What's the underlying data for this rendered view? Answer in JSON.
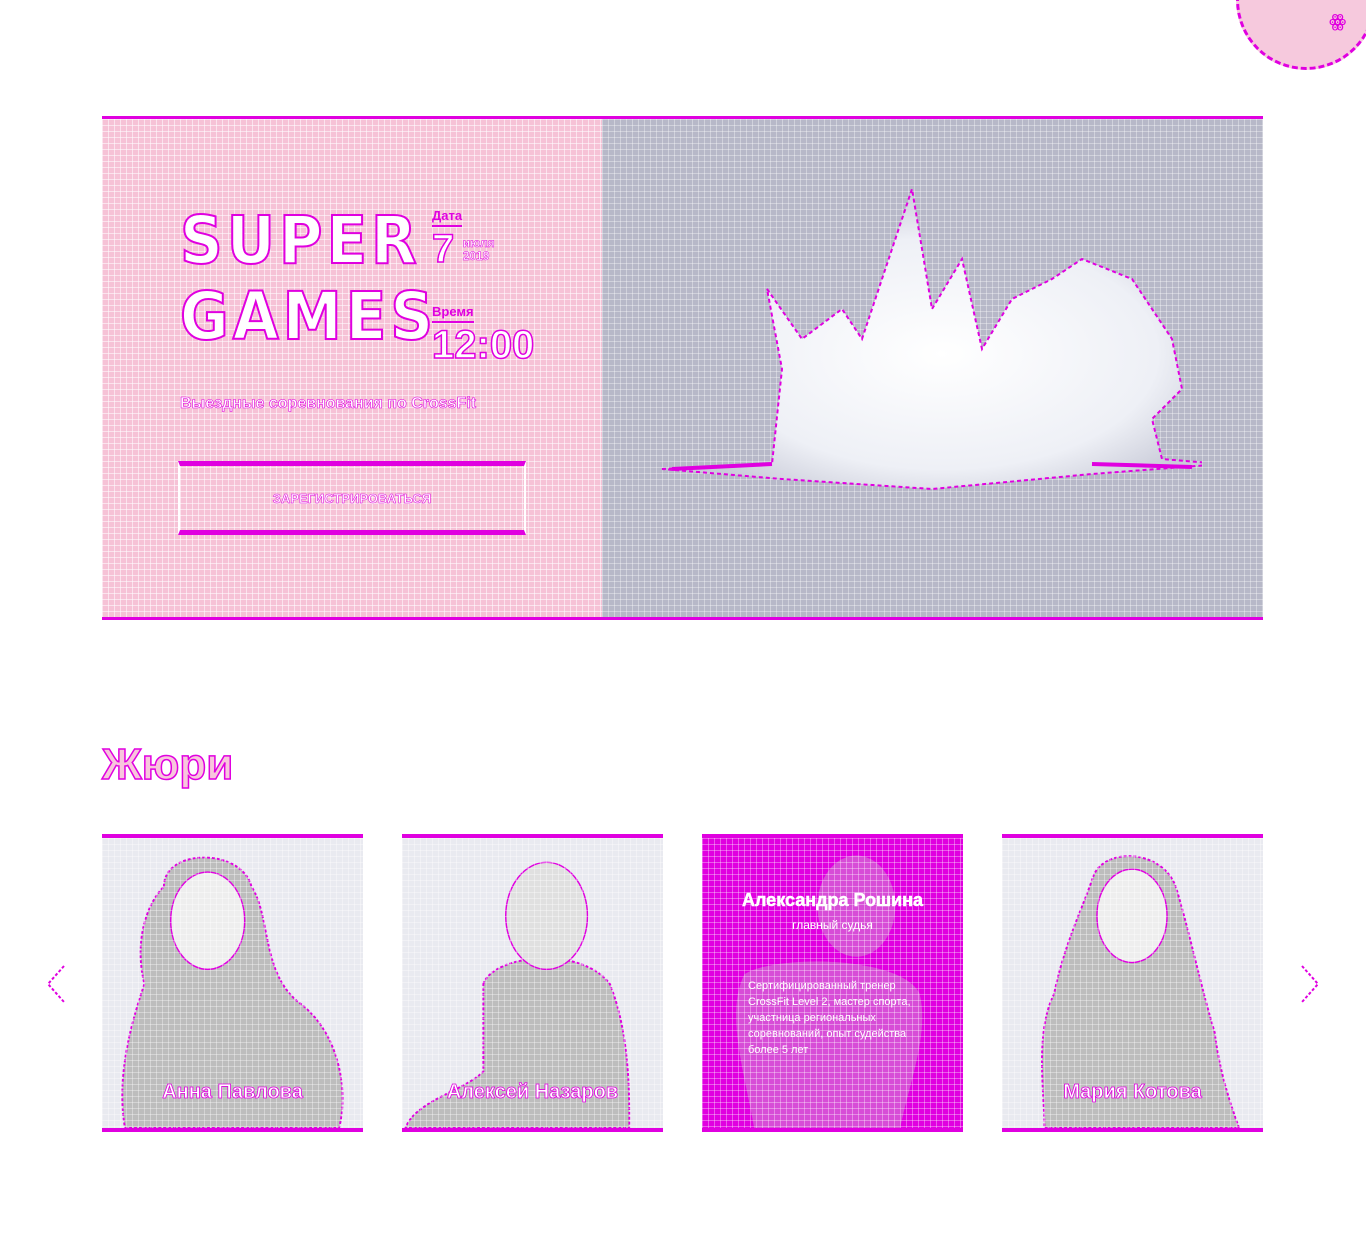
{
  "colors": {
    "accent": "#e000e0",
    "hero_left_bg": "#f6c2d6",
    "hero_right_bg": "#b7b8c8",
    "card_bg": "#e9eaf0"
  },
  "corner": {
    "logo": "ꙮ"
  },
  "hero": {
    "title_line1": "SUPER",
    "title_line2": "GAMES",
    "date_label": "Дата",
    "date_day": "7",
    "date_month": "июля",
    "date_year": "2019",
    "time_label": "Время",
    "time_value": "12:00",
    "subtitle": "Выездные соревнования по CrossFit",
    "register_label": "ЗАРЕГИСТРИРОВАТЬСЯ"
  },
  "jury": {
    "title": "Жюри",
    "prev_icon": "chevron-left-icon",
    "next_icon": "chevron-right-icon",
    "members": [
      {
        "name": "Анна Павлова"
      },
      {
        "name": "Алексей Назаров"
      },
      {
        "name": "Александра Рошина",
        "role": "главный судья",
        "description": "Сертифицированный тренер CrossFit Level 2, мастер спорта, участница региональных соревнований, опыт судейства более 5 лет"
      },
      {
        "name": "Мария Котова"
      }
    ]
  }
}
